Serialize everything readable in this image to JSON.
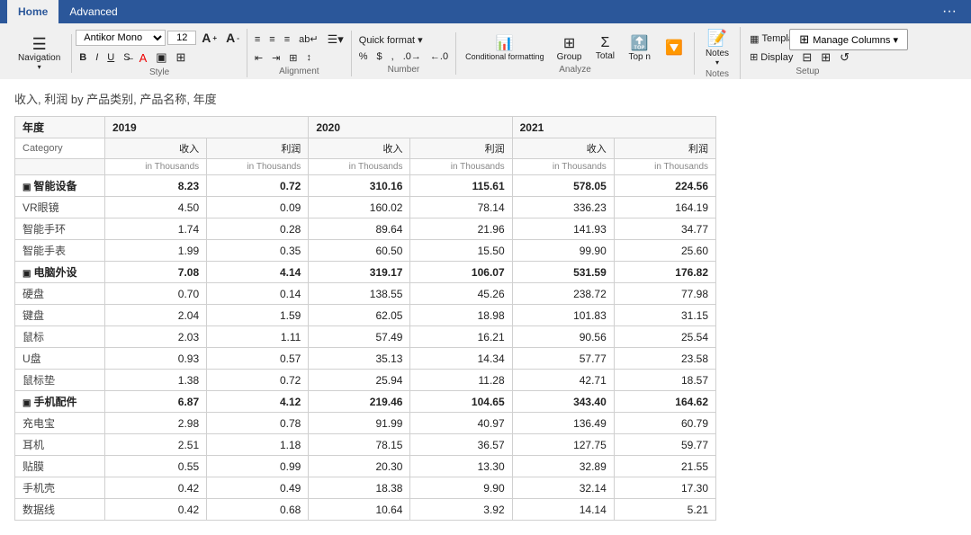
{
  "tabs": {
    "home": "Home",
    "advanced": "Advanced"
  },
  "topRight": "···",
  "manageColumns": "Manage Columns ▾",
  "ribbonSections": {
    "navigation": {
      "label": "Navigation",
      "icon": "☰"
    },
    "style": {
      "label": "Style"
    },
    "alignment": {
      "label": "Alignment"
    },
    "number": {
      "label": "Number"
    },
    "analyze": {
      "label": "Analyze"
    },
    "notes": {
      "label": "Notes"
    },
    "setup": {
      "label": "Setup"
    }
  },
  "font": {
    "family": "Antikor Mono",
    "size": "12"
  },
  "pageTitle": "收入, 利润 by 产品类别, 产品名称, 年度",
  "table": {
    "yearColumn": "年度",
    "categoryColumn": "Category",
    "years": [
      "2019",
      "2020",
      "2021"
    ],
    "colHeaders": [
      "收入",
      "利润",
      "收入",
      "利润",
      "收入",
      "利润"
    ],
    "colSubHeaders": [
      "in Thousands",
      "in Thousands",
      "in Thousands",
      "in Thousands",
      "in Thousands",
      "in Thousands"
    ],
    "categories": [
      {
        "name": "智能设备",
        "totals": [
          "8.23",
          "0.72",
          "310.16",
          "115.61",
          "578.05",
          "224.56"
        ],
        "items": [
          {
            "name": "VR眼镜",
            "values": [
              "4.50",
              "0.09",
              "160.02",
              "78.14",
              "336.23",
              "164.19"
            ]
          },
          {
            "name": "智能手环",
            "values": [
              "1.74",
              "0.28",
              "89.64",
              "21.96",
              "141.93",
              "34.77"
            ]
          },
          {
            "name": "智能手表",
            "values": [
              "1.99",
              "0.35",
              "60.50",
              "15.50",
              "99.90",
              "25.60"
            ]
          }
        ]
      },
      {
        "name": "电脑外设",
        "totals": [
          "7.08",
          "4.14",
          "319.17",
          "106.07",
          "531.59",
          "176.82"
        ],
        "items": [
          {
            "name": "硬盘",
            "values": [
              "0.70",
              "0.14",
              "138.55",
              "45.26",
              "238.72",
              "77.98"
            ]
          },
          {
            "name": "键盘",
            "values": [
              "2.04",
              "1.59",
              "62.05",
              "18.98",
              "101.83",
              "31.15"
            ]
          },
          {
            "name": "鼠标",
            "values": [
              "2.03",
              "1.11",
              "57.49",
              "16.21",
              "90.56",
              "25.54"
            ]
          },
          {
            "name": "U盘",
            "values": [
              "0.93",
              "0.57",
              "35.13",
              "14.34",
              "57.77",
              "23.58"
            ]
          },
          {
            "name": "鼠标垫",
            "values": [
              "1.38",
              "0.72",
              "25.94",
              "11.28",
              "42.71",
              "18.57"
            ]
          }
        ]
      },
      {
        "name": "手机配件",
        "totals": [
          "6.87",
          "4.12",
          "219.46",
          "104.65",
          "343.40",
          "164.62"
        ],
        "items": [
          {
            "name": "充电宝",
            "values": [
              "2.98",
              "0.78",
              "91.99",
              "40.97",
              "136.49",
              "60.79"
            ]
          },
          {
            "name": "耳机",
            "values": [
              "2.51",
              "1.18",
              "78.15",
              "36.57",
              "127.75",
              "59.77"
            ]
          },
          {
            "name": "贴膜",
            "values": [
              "0.55",
              "0.99",
              "20.30",
              "13.30",
              "32.89",
              "21.55"
            ]
          },
          {
            "name": "手机壳",
            "values": [
              "0.42",
              "0.49",
              "18.38",
              "9.90",
              "32.14",
              "17.30"
            ]
          },
          {
            "name": "数据线",
            "values": [
              "0.42",
              "0.68",
              "10.64",
              "3.92",
              "14.14",
              "5.21"
            ]
          }
        ]
      }
    ]
  },
  "toolbar": {
    "navigation_label": "Navigation",
    "style_label": "Style",
    "alignment_label": "Alignment",
    "number_label": "Number",
    "analyze_label": "Analyze",
    "notes_label": "Notes",
    "setup_label": "Setup",
    "conditional_label": "Conditional\nformatting",
    "group_label": "Group",
    "total_label": "Total",
    "topn_label": "Top n",
    "filter_label": "🔽",
    "notes_icon_label": "Notes",
    "templates_label": "Templates",
    "display_label": "Display",
    "bold_label": "B",
    "italic_label": "I",
    "underline_label": "U",
    "quick_format_label": "Quick format ▾",
    "percent_label": "%",
    "dollar_label": "$",
    "comma_label": ","
  }
}
